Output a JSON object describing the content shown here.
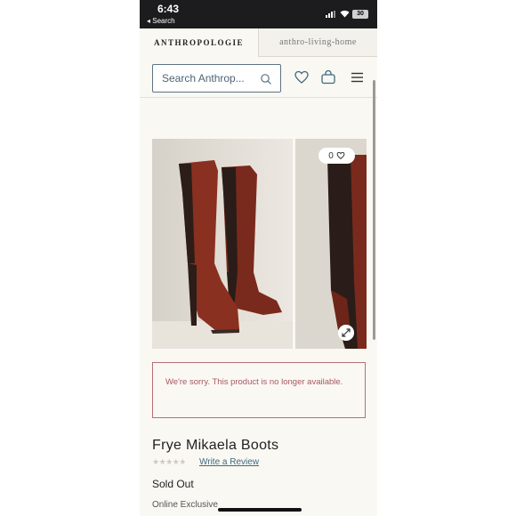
{
  "status_bar": {
    "time": "6:43",
    "back_label": "◂ Search",
    "battery": "30"
  },
  "brand_tabs": {
    "anthropologie": "ANTHROPOLOGIE",
    "home": "anthro-living-home"
  },
  "header": {
    "search_placeholder": "Search Anthrop...",
    "icons": [
      "heart-icon",
      "shopping-bag-icon",
      "menu-icon"
    ]
  },
  "gallery": {
    "like_count": "0",
    "image_count": 5,
    "active_image": 1
  },
  "notice": {
    "message": "We're sorry. This product is no longer available."
  },
  "product": {
    "name": "Frye Mikaela Boots",
    "rating": 0,
    "rating_max": 5,
    "review_link": "Write a Review",
    "stock_status": "Sold Out",
    "badge": "Online Exclusive"
  },
  "colors": {
    "accent": "#5c7385",
    "notice": "#a85863",
    "link": "#3d6a7d",
    "background": "#faf8f3"
  }
}
